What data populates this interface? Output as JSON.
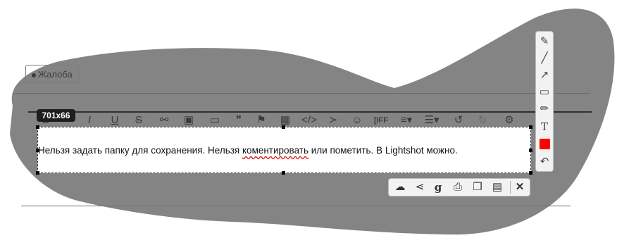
{
  "page": {
    "complaint_label": "Жалоба",
    "size_label": "701x66"
  },
  "editor": {
    "text_before": "Нельзя задать папку для сохранения. Нельзя ",
    "text_misspelled": "коментировать",
    "text_after": " или пометить. В Lightshot можно.",
    "toolbar_icons": [
      "bold-icon",
      "italic-icon",
      "underline-icon",
      "strikethrough-icon",
      "link-icon",
      "image-icon",
      "video-icon",
      "quote-icon",
      "flag-icon",
      "media-icon",
      "code-icon",
      "spoiler-icon",
      "smiley-icon",
      "bbcode-icon",
      "align-icon",
      "list-icon",
      "undo-icon",
      "redo-icon",
      "settings-icon"
    ]
  },
  "side_toolbar": {
    "tools": [
      "pen-icon",
      "line-icon",
      "arrow-icon",
      "rectangle-icon",
      "marker-icon",
      "text-icon",
      "color-swatch",
      "undo-icon"
    ],
    "color": "#ff0000"
  },
  "bottom_toolbar": {
    "actions": [
      "upload-icon",
      "share-icon",
      "google-search-icon",
      "print-icon",
      "copy-icon",
      "save-icon",
      "close-icon"
    ]
  },
  "colors": {
    "overlay": "#848484",
    "accent": "#ff0000"
  }
}
